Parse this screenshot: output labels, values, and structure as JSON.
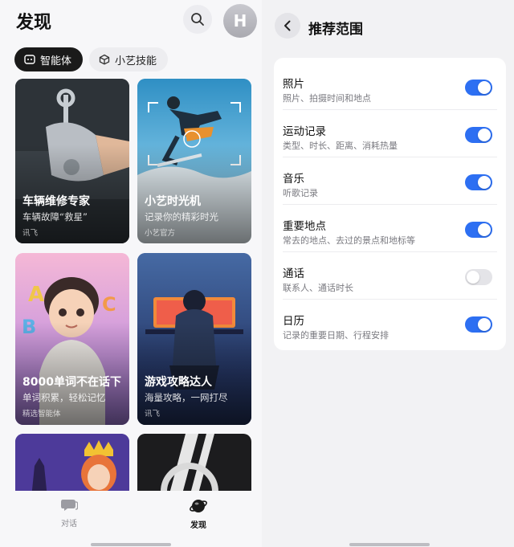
{
  "discover": {
    "title": "发现",
    "avatar_letter": "H",
    "tabs": [
      {
        "label": "智能体",
        "active": true
      },
      {
        "label": "小艺技能",
        "active": false
      }
    ],
    "cards": [
      {
        "title": "车辆维修专家",
        "subtitle": "车辆故障“救星”",
        "source": "讯飞"
      },
      {
        "title": "小艺时光机",
        "subtitle": "记录你的精彩时光",
        "source": "小艺官方"
      },
      {
        "title": "8000单词不在话下",
        "subtitle": "单词积累，轻松记忆",
        "source": "精选智能体"
      },
      {
        "title": "游戏攻略达人",
        "subtitle": "海量攻略，一网打尽",
        "source": "讯飞"
      }
    ],
    "nav": [
      {
        "label": "对话",
        "icon": "chat-bubble-icon",
        "active": false
      },
      {
        "label": "发现",
        "icon": "discover-planet-icon",
        "active": true
      }
    ]
  },
  "settings": {
    "title": "推荐范围",
    "items": [
      {
        "label": "照片",
        "desc": "照片、拍摄时间和地点",
        "enabled": true
      },
      {
        "label": "运动记录",
        "desc": "类型、时长、距离、消耗热量",
        "enabled": true
      },
      {
        "label": "音乐",
        "desc": "听歌记录",
        "enabled": true
      },
      {
        "label": "重要地点",
        "desc": "常去的地点、去过的景点和地标等",
        "enabled": true
      },
      {
        "label": "通话",
        "desc": "联系人、通话时长",
        "enabled": false
      },
      {
        "label": "日历",
        "desc": "记录的重要日期、行程安排",
        "enabled": true
      }
    ]
  },
  "colors": {
    "toggle_on": "#2d6ff2",
    "toggle_off": "#e4e4e8",
    "active_tab": "#1a1a1a"
  }
}
